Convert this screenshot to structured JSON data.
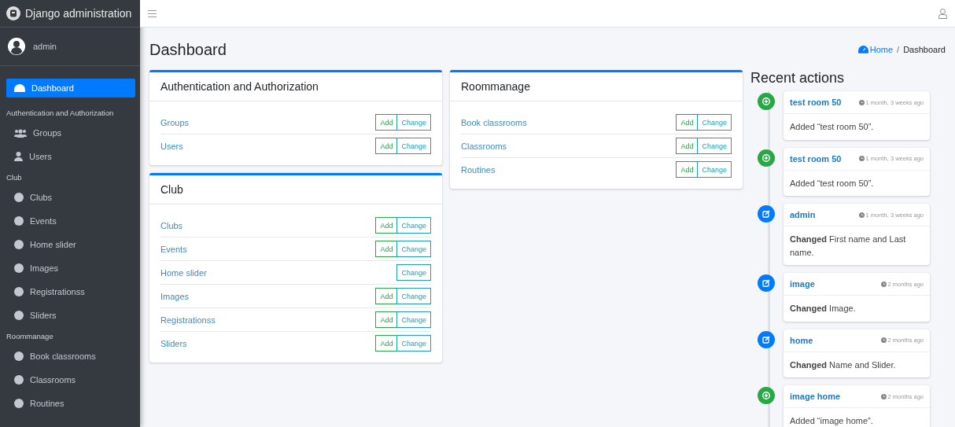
{
  "brand": {
    "title": "Django administration"
  },
  "user": {
    "name": "admin"
  },
  "sidebar": {
    "items": [
      {
        "kind": "dashboard",
        "label": "Dashboard",
        "selected": true
      },
      {
        "kind": "section",
        "label": "Authentication and Authorization"
      },
      {
        "kind": "groups",
        "label": "Groups",
        "selected": false
      },
      {
        "kind": "users",
        "label": "Users",
        "selected": false
      },
      {
        "kind": "section",
        "label": "Club"
      },
      {
        "kind": "model",
        "label": "Clubs",
        "selected": false
      },
      {
        "kind": "model",
        "label": "Events",
        "selected": false
      },
      {
        "kind": "model",
        "label": "Home slider",
        "selected": false
      },
      {
        "kind": "model",
        "label": "Images",
        "selected": false
      },
      {
        "kind": "model",
        "label": "Registrationss",
        "selected": false
      },
      {
        "kind": "model",
        "label": "Sliders",
        "selected": false
      },
      {
        "kind": "section",
        "label": "Roommanage"
      },
      {
        "kind": "model",
        "label": "Book classrooms",
        "selected": false
      },
      {
        "kind": "model",
        "label": "Classrooms",
        "selected": false
      },
      {
        "kind": "model",
        "label": "Routines",
        "selected": false
      }
    ]
  },
  "page": {
    "title": "Dashboard",
    "breadcrumb": [
      "Home",
      "/",
      "Dashboard"
    ]
  },
  "app_columns": [
    {
      "apps": [
        {
          "title": "Authentication and Authorization",
          "models": [
            {
              "name": "Groups",
              "add": "Add",
              "change": "Change"
            },
            {
              "name": "Users",
              "add": "Add",
              "change": "Change"
            }
          ]
        },
        {
          "title": "Club",
          "models": [
            {
              "name": "Clubs",
              "add": "Add",
              "change": "Change"
            },
            {
              "name": "Events",
              "add": "Add",
              "change": "Change"
            },
            {
              "name": "Home slider",
              "change": "Change"
            },
            {
              "name": "Images",
              "add": "Add",
              "change": "Change"
            },
            {
              "name": "Registrationss",
              "add": "Add",
              "change": "Change"
            },
            {
              "name": "Sliders",
              "add": "Add",
              "change": "Change"
            }
          ]
        }
      ]
    },
    {
      "apps": [
        {
          "title": "Roommanage",
          "models": [
            {
              "name": "Book classrooms",
              "add": "Add",
              "change": "Change"
            },
            {
              "name": "Classrooms",
              "add": "Add",
              "change": "Change"
            },
            {
              "name": "Routines",
              "add": "Add",
              "change": "Change"
            }
          ]
        }
      ]
    }
  ],
  "recent_actions": {
    "title": "Recent actions",
    "items": [
      {
        "kind": "addition",
        "object": "test room 50",
        "time": "1 month, 3 weeks ago",
        "message": "Added “test room 50”."
      },
      {
        "kind": "addition",
        "object": "test room 50",
        "time": "1 month, 3 weeks ago",
        "message": "Added “test room 50”."
      },
      {
        "kind": "change",
        "object": "admin",
        "time": "1 month, 3 weeks ago",
        "message": "**Changed** First name and Last name."
      },
      {
        "kind": "change",
        "object": "image",
        "time": "2 months ago",
        "message": "**Changed** Image."
      },
      {
        "kind": "change",
        "object": "home",
        "time": "2 months ago",
        "message": "**Changed** Name and Slider."
      },
      {
        "kind": "addition",
        "object": "image home",
        "time": "2 months ago",
        "message": "Added “image home”."
      }
    ]
  }
}
